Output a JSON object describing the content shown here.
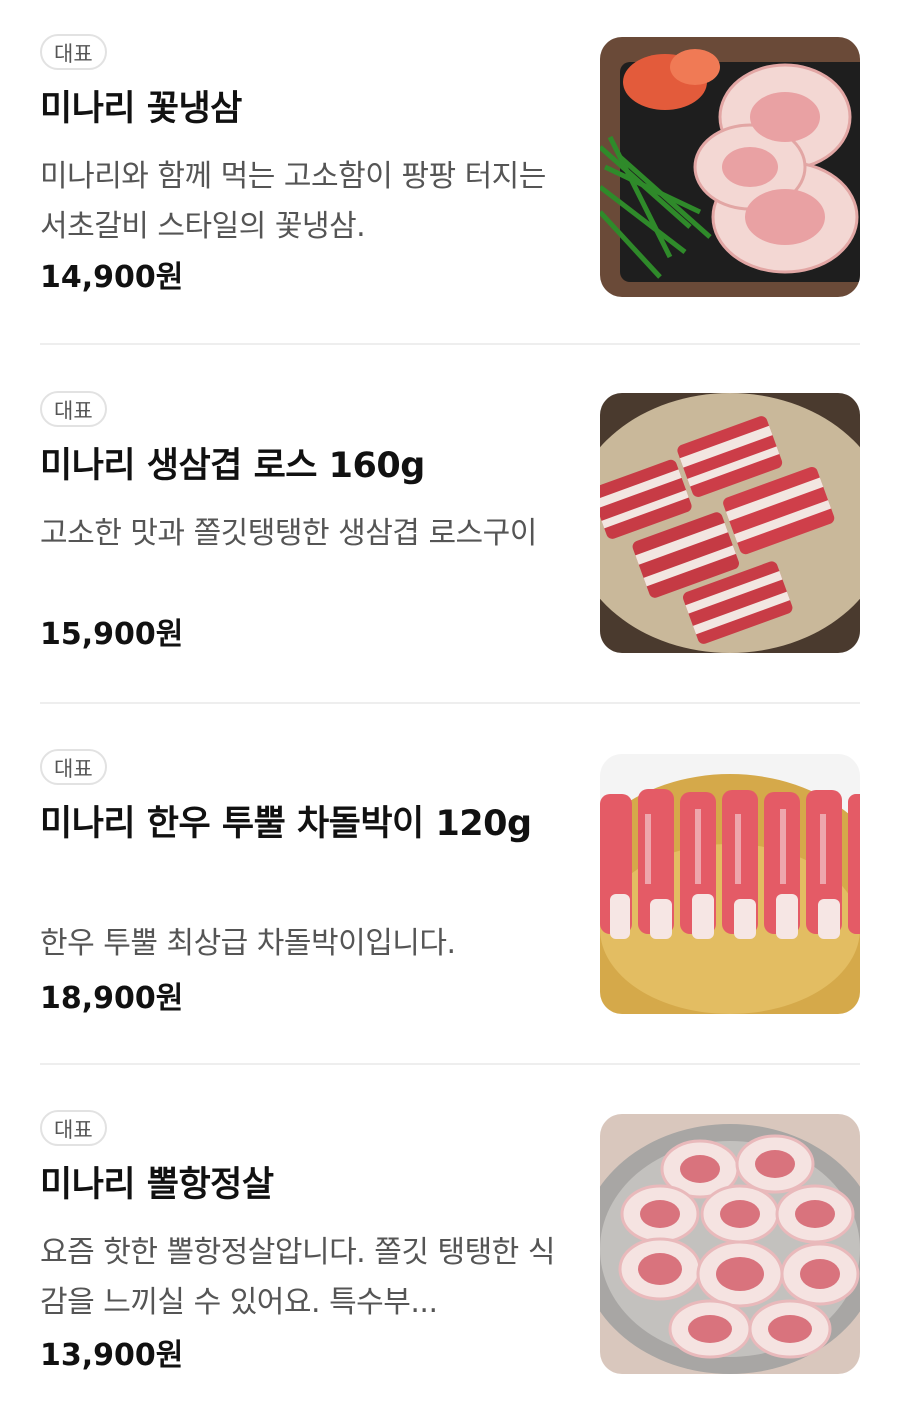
{
  "menu": {
    "items": [
      {
        "badge": "대표",
        "name": "미나리 꽃냉삼",
        "description": "미나리와 함께 먹는 고소함이 팡팡 터지는 서초갈비 스타일의 꽃냉삼.",
        "price": "14,900원",
        "image": "frozen-pork-belly-with-minari-and-kimchi"
      },
      {
        "badge": "대표",
        "name": "미나리 생삼겹 로스 160g",
        "description": "고소한 맛과 쫄깃탱탱한 생삼겹 로스구이",
        "price": "15,900원",
        "image": "raw-pork-belly-blocks-on-plate"
      },
      {
        "badge": "대표",
        "name": "미나리 한우 투뿔 차돌박이 120g",
        "description": "한우 투뿔 최상급 차돌박이입니다.",
        "price": "18,900원",
        "image": "rolled-beef-brisket-on-brass-plate"
      },
      {
        "badge": "대표",
        "name": "미나리 뽈항정살",
        "description": "요즘 핫한 뽈항정살압니다. 쫄깃 탱탱한 식감을 느끼실 수 있어요. 특수부...",
        "price": "13,900원",
        "image": "sliced-pork-jowl-on-plate"
      }
    ]
  },
  "colors": {
    "badge_border": "#e2e2e2",
    "text_primary": "#111111",
    "text_secondary": "#555555",
    "divider": "#eeeeee"
  }
}
